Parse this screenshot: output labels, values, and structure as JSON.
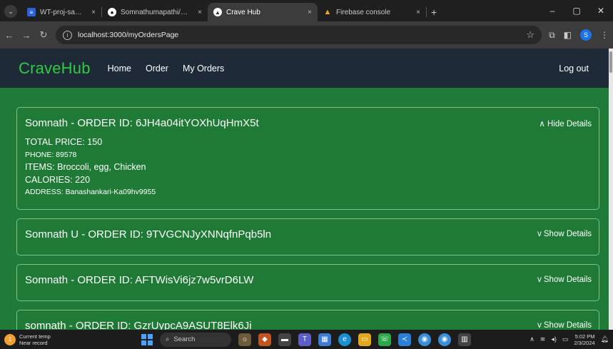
{
  "browser": {
    "tabs": [
      {
        "title": "WT-proj-sample-report.docx -",
        "active": false,
        "favicon_color": "#2b62d8"
      },
      {
        "title": "Somnathumapathi/CraveHub",
        "active": false,
        "favicon_color": "#ffffff"
      },
      {
        "title": "Crave Hub",
        "active": true,
        "favicon_color": "#ffffff"
      },
      {
        "title": "Firebase console",
        "active": false,
        "favicon_color": "#f5a623"
      }
    ],
    "new_tab_label": "+",
    "url": "localhost:3000/myOrdersPage",
    "profile_initial": "S"
  },
  "app": {
    "brand": "CraveHub",
    "nav": [
      "Home",
      "Order",
      "My Orders"
    ],
    "logout": "Log out"
  },
  "orders": [
    {
      "title": "Somnath - ORDER ID: 6JH4a04itYOXhUqHmX5t",
      "toggle": "∧ Hide Details",
      "expanded": true,
      "total_price": "TOTAL PRICE: 150",
      "phone": "PHONE: 89578",
      "items": "ITEMS: Broccoli, egg, Chicken",
      "calories": "CALORIES: 220",
      "address": "ADDRESS: Banashankari-Ka09hv9955"
    },
    {
      "title": "Somnath U - ORDER ID: 9TVGCNJyXNNqfnPqb5ln",
      "toggle": "v Show Details",
      "expanded": false
    },
    {
      "title": "Somnath - ORDER ID: AFTWisVi6jz7w5vrD6LW",
      "toggle": "v Show Details",
      "expanded": false
    },
    {
      "title": "somnath - ORDER ID: GzrUypcA9ASUT8Elk6Ji",
      "toggle": "v Show Details",
      "expanded": false
    }
  ],
  "taskbar": {
    "weather_title": "Current temp",
    "weather_sub": "Near record",
    "weather_badge": "1",
    "search_placeholder": "Search",
    "time": "5:02 PM",
    "date": "2/3/2024"
  },
  "colors": {
    "brand": "#2ecc40",
    "page_bg": "#207a38",
    "navbar_bg": "#1e2a38",
    "card_border": "#7fbf8e"
  }
}
